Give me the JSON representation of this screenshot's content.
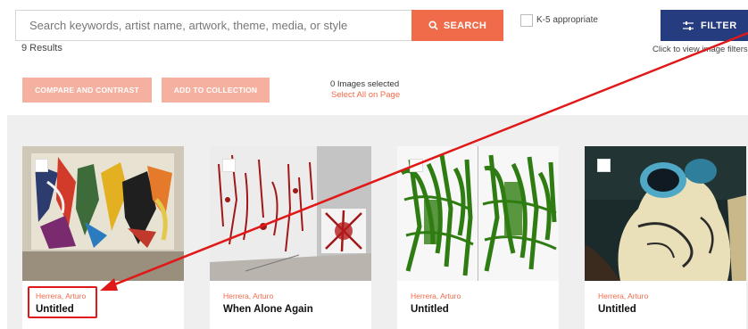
{
  "search": {
    "placeholder": "Search keywords, artist name, artwork, theme, media, or style",
    "button_label": "SEARCH"
  },
  "k5": {
    "label": "K-5 appropriate",
    "checked": false
  },
  "filter": {
    "button_label": "FILTER",
    "hint": "Click to view image filters"
  },
  "results": {
    "count_label": "9 Results"
  },
  "actions": {
    "compare_label": "COMPARE AND CONTRAST",
    "collection_label": "ADD TO COLLECTION",
    "selected_label": "0 Images selected",
    "select_all_label": "Select All on Page"
  },
  "cards": [
    {
      "artist": "Herrera, Arturo",
      "title": "Untitled"
    },
    {
      "artist": "Herrera, Arturo",
      "title": "When Alone Again"
    },
    {
      "artist": "Herrera, Arturo",
      "title": "Untitled"
    },
    {
      "artist": "Herrera, Arturo",
      "title": "Untitled"
    }
  ],
  "colors": {
    "accent": "#f06b4a",
    "filter_bg": "#253d7e",
    "annotation": "#e01818"
  },
  "icons": {
    "search": "search-icon",
    "filter": "sliders-icon"
  }
}
